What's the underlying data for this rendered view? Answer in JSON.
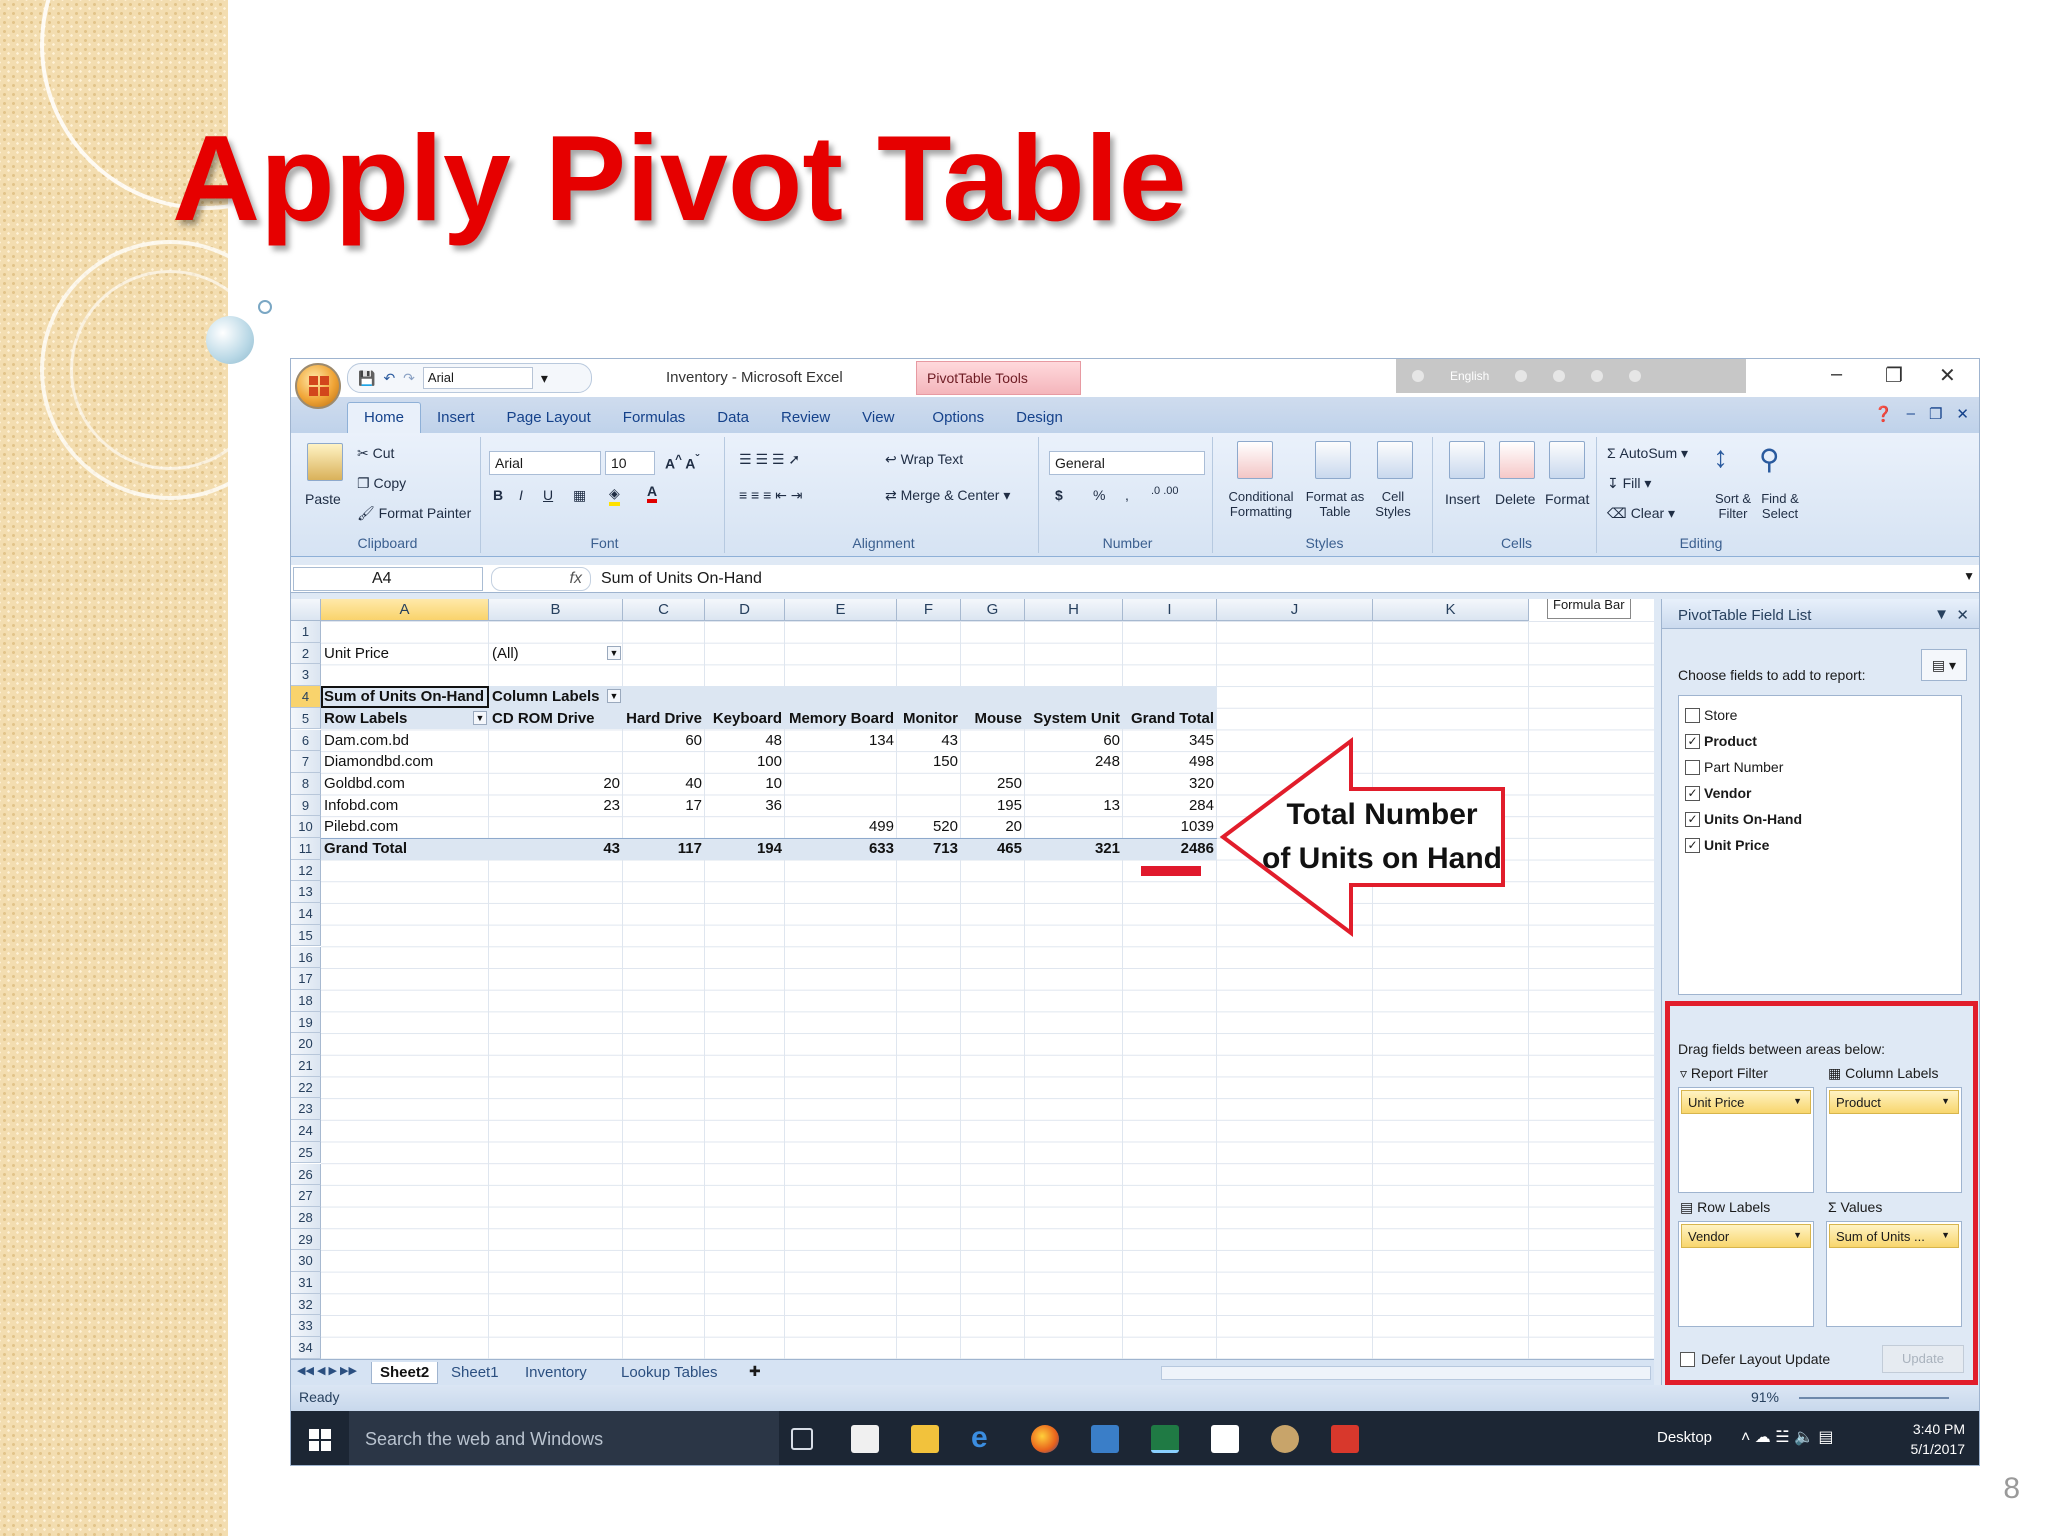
{
  "slide": {
    "title": "Apply Pivot Table",
    "page_number": "8",
    "colors": {
      "title": "#e60000",
      "accent_red": "#e11d2b"
    }
  },
  "excel": {
    "window_title": "Inventory - Microsoft Excel",
    "context_tools": "PivotTable Tools",
    "qat_font": "Arial",
    "lang_bar_label": "English",
    "tabs": [
      "Home",
      "Insert",
      "Page Layout",
      "Formulas",
      "Data",
      "Review",
      "View",
      "Options",
      "Design"
    ],
    "ribbon": {
      "clipboard": {
        "paste": "Paste",
        "cut": "Cut",
        "copy": "Copy",
        "format_painter": "Format Painter",
        "label": "Clipboard"
      },
      "font": {
        "name": "Arial",
        "size": "10",
        "bold": "B",
        "italic": "I",
        "underline": "U",
        "label": "Font"
      },
      "alignment": {
        "wrap_text": "Wrap Text",
        "merge_center": "Merge & Center",
        "label": "Alignment"
      },
      "number": {
        "format": "General",
        "currency": "$",
        "percent": "%",
        "comma": ",",
        "label": "Number"
      },
      "styles": {
        "conditional": "Conditional Formatting",
        "format_table": "Format as Table",
        "cell_styles": "Cell Styles",
        "label": "Styles"
      },
      "cells": {
        "insert": "Insert",
        "delete": "Delete",
        "format": "Format",
        "label": "Cells"
      },
      "editing": {
        "autosum": "AutoSum",
        "fill": "Fill",
        "clear": "Clear",
        "sort_filter": "Sort & Filter",
        "find_select": "Find & Select",
        "label": "Editing"
      }
    },
    "name_box": "A4",
    "fx": "fx",
    "formula": "Sum of Units On-Hand",
    "formula_bar_tooltip": "Formula Bar",
    "columns": [
      "A",
      "B",
      "C",
      "D",
      "E",
      "F",
      "G",
      "H",
      "I",
      "J",
      "K"
    ],
    "rows": [
      "1",
      "2",
      "3",
      "4",
      "5",
      "6",
      "7",
      "8",
      "9",
      "10",
      "11",
      "12",
      "13",
      "14",
      "15",
      "16",
      "17",
      "18",
      "19",
      "20",
      "21",
      "22",
      "23",
      "24",
      "25",
      "26",
      "27",
      "28",
      "29",
      "30",
      "31",
      "32",
      "33",
      "34"
    ],
    "pivot": {
      "filter_label": "Unit Price",
      "filter_value": "(All)",
      "value_label": "Sum of Units On-Hand",
      "column_labels": "Column Labels",
      "row_labels": "Row Labels",
      "headers": [
        "CD ROM Drive",
        "Hard Drive",
        "Keyboard",
        "Memory Board",
        "Monitor",
        "Mouse",
        "System Unit",
        "Grand Total"
      ],
      "data": [
        {
          "vendor": "Dam.com.bd",
          "values": [
            "",
            "60",
            "48",
            "134",
            "43",
            "",
            "60",
            "345"
          ]
        },
        {
          "vendor": "Diamondbd.com",
          "values": [
            "",
            "",
            "100",
            "",
            "150",
            "",
            "248",
            "498"
          ]
        },
        {
          "vendor": "Goldbd.com",
          "values": [
            "20",
            "40",
            "10",
            "",
            "",
            "250",
            "",
            "320"
          ]
        },
        {
          "vendor": "Infobd.com",
          "values": [
            "23",
            "17",
            "36",
            "",
            "",
            "195",
            "13",
            "284"
          ]
        },
        {
          "vendor": "Pilebd.com",
          "values": [
            "",
            "",
            "",
            "499",
            "520",
            "20",
            "",
            "1039"
          ]
        }
      ],
      "grand_total_label": "Grand Total",
      "grand_totals": [
        "43",
        "117",
        "194",
        "633",
        "713",
        "465",
        "321",
        "2486"
      ]
    },
    "callout": {
      "line1": "Total Number",
      "line2": "of Units on Hand"
    },
    "sheet_tabs": [
      "Sheet2",
      "Sheet1",
      "Inventory",
      "Lookup Tables"
    ],
    "status": "Ready",
    "zoom": "91%",
    "field_list": {
      "title": "PivotTable Field List",
      "choose": "Choose fields to add to report:",
      "fields": [
        {
          "name": "Store",
          "checked": false
        },
        {
          "name": "Product",
          "checked": true
        },
        {
          "name": "Part Number",
          "checked": false
        },
        {
          "name": "Vendor",
          "checked": true
        },
        {
          "name": "Units On-Hand",
          "checked": true
        },
        {
          "name": "Unit Price",
          "checked": true
        }
      ],
      "drag_label": "Drag fields between areas below:",
      "report_filter": "Report Filter",
      "column_labels": "Column Labels",
      "row_labels": "Row Labels",
      "values": "Values",
      "report_filter_item": "Unit Price",
      "column_item": "Product",
      "row_item": "Vendor",
      "values_item": "Sum of Units ...",
      "defer": "Defer Layout Update",
      "update": "Update"
    },
    "taskbar": {
      "search": "Search the web and Windows",
      "desktop": "Desktop",
      "time": "3:40 PM",
      "date": "5/1/2017"
    }
  }
}
